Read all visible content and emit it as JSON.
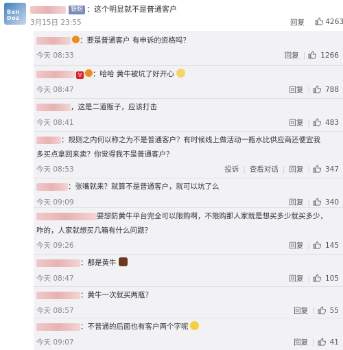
{
  "main_comment": {
    "avatar_text": "Ban Doz",
    "badge": "铁粉",
    "text": "：这个明显就不是普通客户",
    "date": "3月15日 23:55",
    "reply_label": "回复",
    "likes": "4263"
  },
  "replies": [
    {
      "text": "：要是普通客户 有申诉的资格吗？",
      "time": "今天 08:33",
      "reply_label": "回复",
      "likes": "1266"
    },
    {
      "text": "：哈哈 黄牛被坑了好开心",
      "time": "今天 08:47",
      "reply_label": "回复",
      "likes": "788"
    },
    {
      "text": "，这是二道贩子，应该打击",
      "time": "今天 08:41",
      "reply_label": "回复",
      "likes": "483"
    },
    {
      "line1": "：规则之内何以称之为不是普通客户？有时候线上做活动一瓶水比供应商还便宜我",
      "line2": "多买点拿回来卖？你觉得我不是普通客户？",
      "time": "今天 08:53",
      "report_label": "投诉",
      "view_label": "查看对话",
      "reply_label": "回复",
      "likes": "347"
    },
    {
      "text": "：张嘴就来？就算不是普通客户，就可以坑了么",
      "time": "今天 09:09",
      "reply_label": "回复",
      "likes": "340"
    },
    {
      "line1": "要想防黄牛平台完全可以限购啊，不限购那人家就是想买多少就买多少，",
      "line2": "咋的，人家就想买几箱有什么问题？",
      "time": "今天 09:26",
      "reply_label": "回复",
      "likes": "145"
    },
    {
      "text": "：都是黄牛",
      "time": "今天 08:47",
      "reply_label": "回复",
      "likes": "105"
    },
    {
      "text": "：黄牛一次就买两瓶？",
      "time": "今天 08:57",
      "reply_label": "回复",
      "likes": "55"
    },
    {
      "text": "：不普通的后面也有客户两个字呢",
      "time": "今天 09:07",
      "reply_label": "回复",
      "likes": "41"
    }
  ],
  "icons": {
    "like": "thumbs-up-icon",
    "badge_v": "vip-badge-icon",
    "fan": "fire-fan-icon"
  },
  "colors": {
    "panel_bg": "#f2f2f5",
    "badge_bg": "#7b8ab8",
    "name_blur": "#e8b2b2",
    "vip": "#e0232a"
  }
}
